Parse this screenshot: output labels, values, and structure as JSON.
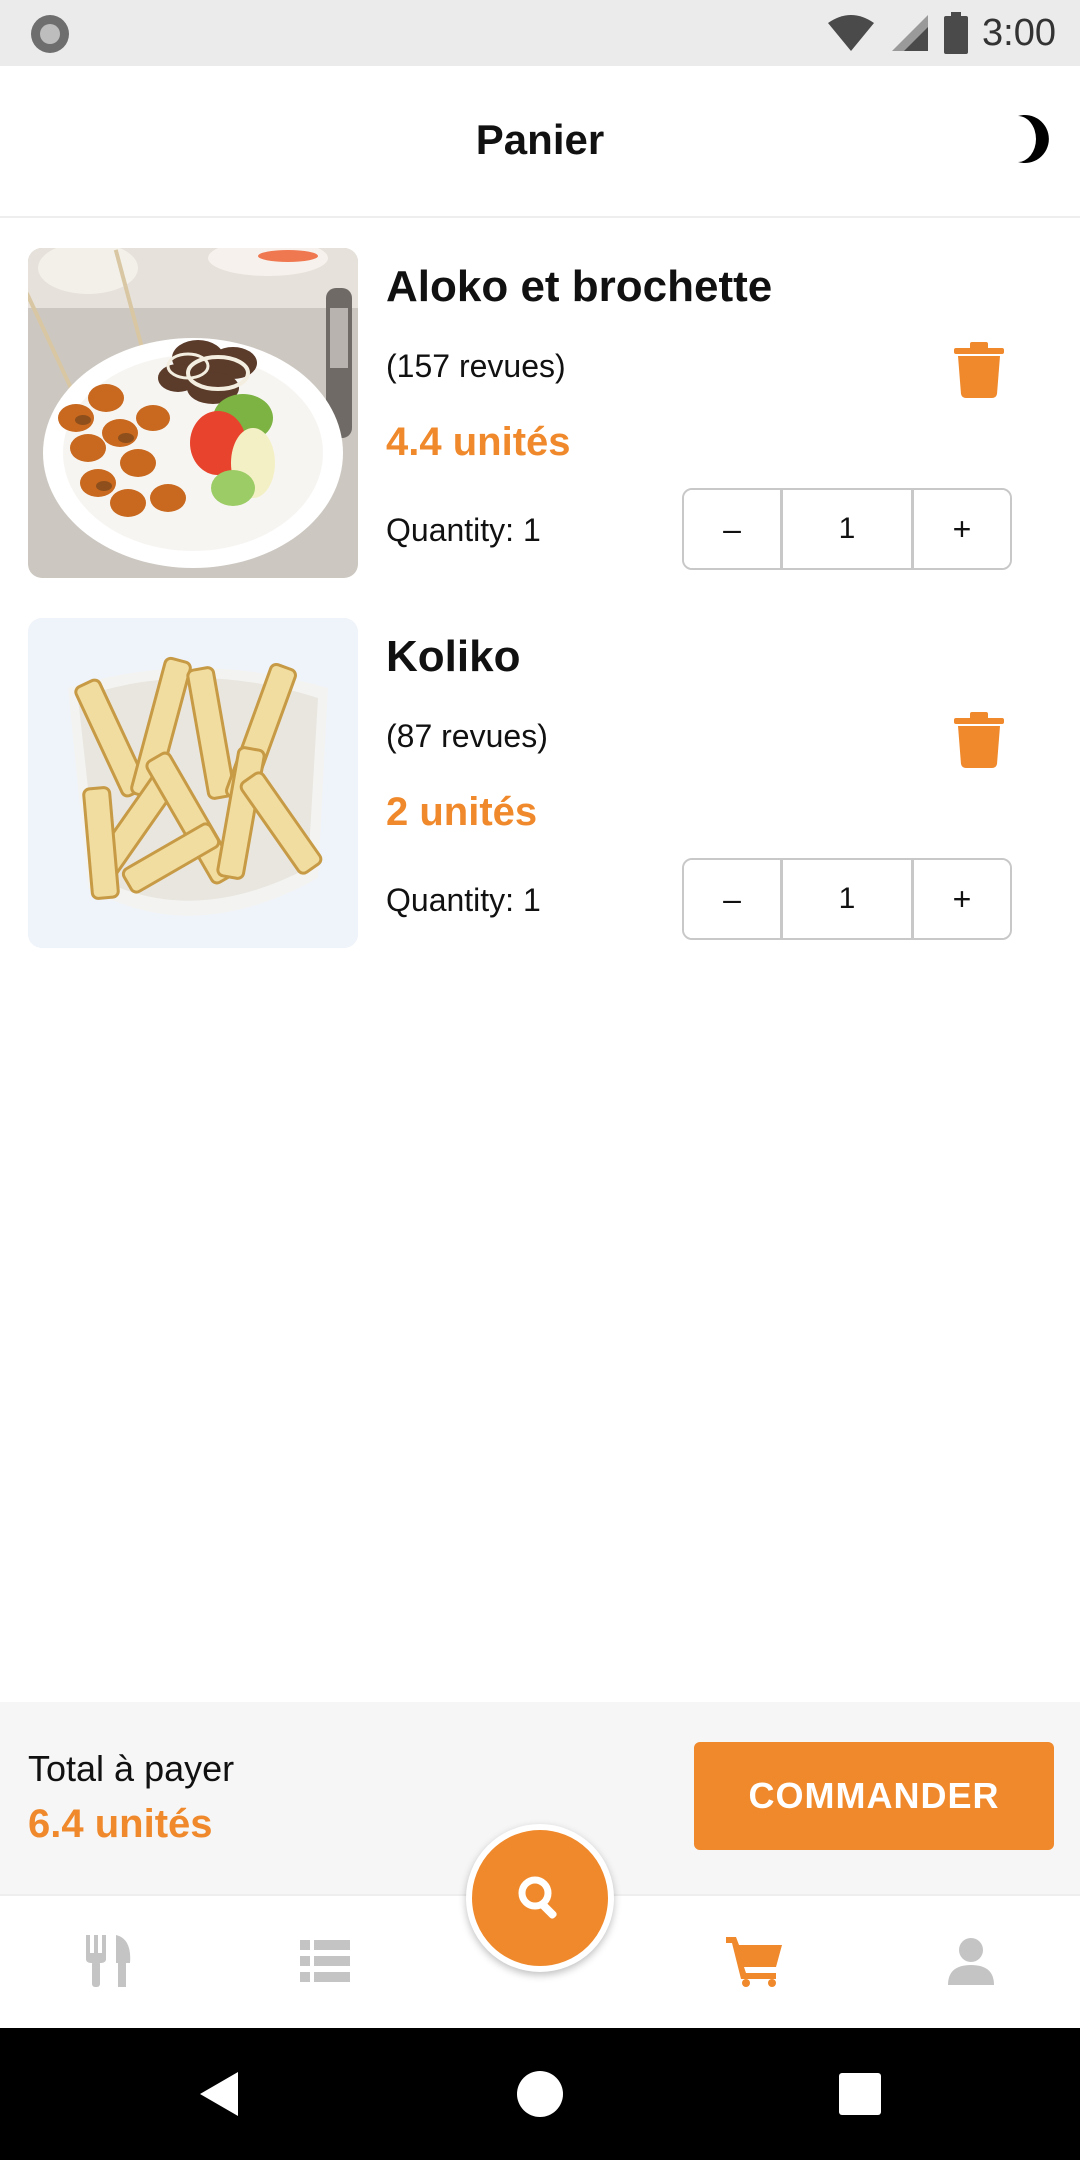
{
  "status_bar": {
    "time": "3:00",
    "icons": [
      "wifi-icon",
      "signal-icon",
      "battery-icon"
    ]
  },
  "header": {
    "title": "Panier",
    "theme_toggle_icon": "moon-icon"
  },
  "cart": {
    "items": [
      {
        "name": "Aloko et brochette",
        "reviews": "(157 revues)",
        "price": "4.4 unités",
        "quantity_label": "Quantity: 1",
        "quantity_value": "1",
        "decrement_label": "–",
        "increment_label": "+",
        "image": "aloko-et-brochette-photo"
      },
      {
        "name": "Koliko",
        "reviews": "(87 revues)",
        "price": "2 unités",
        "quantity_label": "Quantity: 1",
        "quantity_value": "1",
        "decrement_label": "–",
        "increment_label": "+",
        "image": "koliko-photo"
      }
    ]
  },
  "summary": {
    "total_label": "Total à payer",
    "total_amount": "6.4 unités",
    "order_button": "COMMANDER"
  },
  "bottom_nav": {
    "items": [
      {
        "icon": "fork-knife-icon",
        "active": false
      },
      {
        "icon": "list-icon",
        "active": false
      },
      {
        "icon": "search-icon",
        "active": false,
        "floating": true
      },
      {
        "icon": "cart-icon",
        "active": true
      },
      {
        "icon": "user-icon",
        "active": false
      }
    ]
  },
  "colors": {
    "accent": "#f0892b",
    "inactive_icon": "#c4c4c4",
    "text": "#111111"
  }
}
